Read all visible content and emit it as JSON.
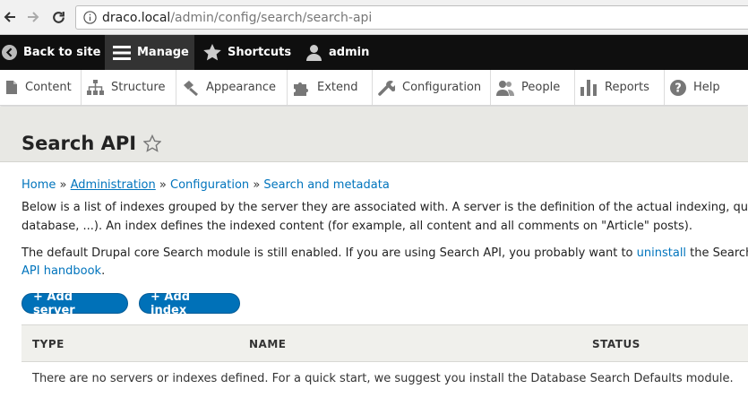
{
  "browser": {
    "url_host": "draco.local",
    "url_path": "/admin/config/search/search-api"
  },
  "toolbar": {
    "back_to_site": "Back to site",
    "manage": "Manage",
    "shortcuts": "Shortcuts",
    "user": "admin"
  },
  "tray": {
    "items": [
      {
        "label": "Content",
        "icon": "page-icon"
      },
      {
        "label": "Structure",
        "icon": "sitemap-icon"
      },
      {
        "label": "Appearance",
        "icon": "paintbrush-icon"
      },
      {
        "label": "Extend",
        "icon": "puzzle-icon"
      },
      {
        "label": "Configuration",
        "icon": "wrench-icon"
      },
      {
        "label": "People",
        "icon": "people-icon"
      },
      {
        "label": "Reports",
        "icon": "bar-chart-icon"
      },
      {
        "label": "Help",
        "icon": "help-icon"
      }
    ]
  },
  "page": {
    "title": "Search API"
  },
  "breadcrumb": {
    "items": [
      "Home",
      "Administration",
      "Configuration",
      "Search and metadata"
    ],
    "separator": "»"
  },
  "description": {
    "line1": "Below is a list of indexes grouped by the server they are associated with. A server is the definition of the actual indexing, qu",
    "line2": "database, ...). An index defines the indexed content (for example, all content and all comments on \"Article\" posts).",
    "line3_pre": "The default Drupal core Search module is still enabled. If you are using Search API, you probably want to ",
    "line3_link": "uninstall",
    "line3_post": " the Search",
    "line4_link": "API handbook",
    "line4_post": "."
  },
  "actions": {
    "add_server": "+ Add server",
    "add_index": "+ Add index"
  },
  "table": {
    "columns": [
      "TYPE",
      "NAME",
      "STATUS"
    ],
    "empty_message": "There are no servers or indexes defined. For a quick start, we suggest you install the Database Search Defaults module."
  },
  "colors": {
    "toolbar_bg": "#0f0f0f",
    "link": "#0074bd",
    "button_bg": "#0071b8",
    "header_bg": "#e8e8e4"
  }
}
